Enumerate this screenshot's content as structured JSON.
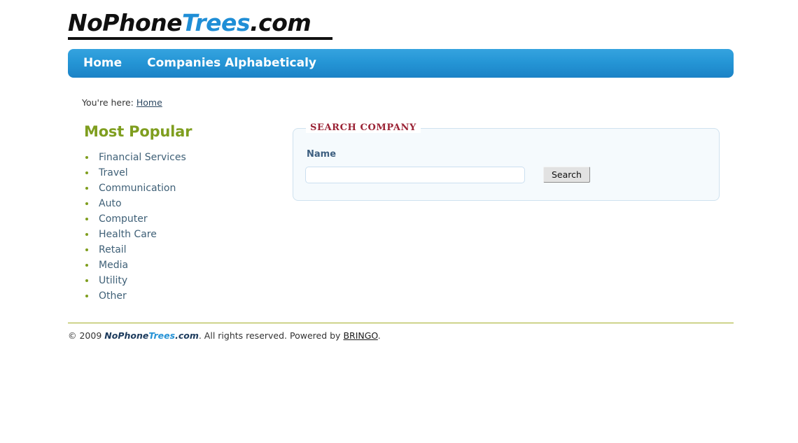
{
  "header": {
    "logo": {
      "part_dark_1": "NoPhone",
      "part_blue": "Trees",
      "part_dark_2": ".com"
    }
  },
  "nav": {
    "items": [
      {
        "label": "Home"
      },
      {
        "label": "Companies Alphabeticaly"
      }
    ]
  },
  "breadcrumb": {
    "prefix": "You're here:",
    "current": "Home"
  },
  "sidebar": {
    "title": "Most Popular",
    "items": [
      {
        "label": "Financial Services"
      },
      {
        "label": "Travel"
      },
      {
        "label": "Communication"
      },
      {
        "label": "Auto"
      },
      {
        "label": "Computer"
      },
      {
        "label": "Health Care"
      },
      {
        "label": "Retail"
      },
      {
        "label": "Media"
      },
      {
        "label": "Utility"
      },
      {
        "label": "Other"
      }
    ]
  },
  "search": {
    "legend": "SEARCH COMPANY",
    "name_label": "Name",
    "name_value": "",
    "name_placeholder": "",
    "button_label": "Search"
  },
  "footer": {
    "copyright": "© 2009",
    "logo": {
      "part_dark_1": "NoPhone",
      "part_blue": "Trees",
      "part_dark_2": ".com"
    },
    "rights": ". All rights reserved. Powered by",
    "powered_by_link": "BRINGO",
    "end_period": "."
  },
  "colors": {
    "nav_blue": "#2596d6",
    "logo_blue": "#1f8ed6",
    "accent_olive": "#7f9e1f",
    "legend_red": "#9b2335",
    "label_slate": "#3d5f80",
    "rule_olive": "#a3ad27"
  }
}
